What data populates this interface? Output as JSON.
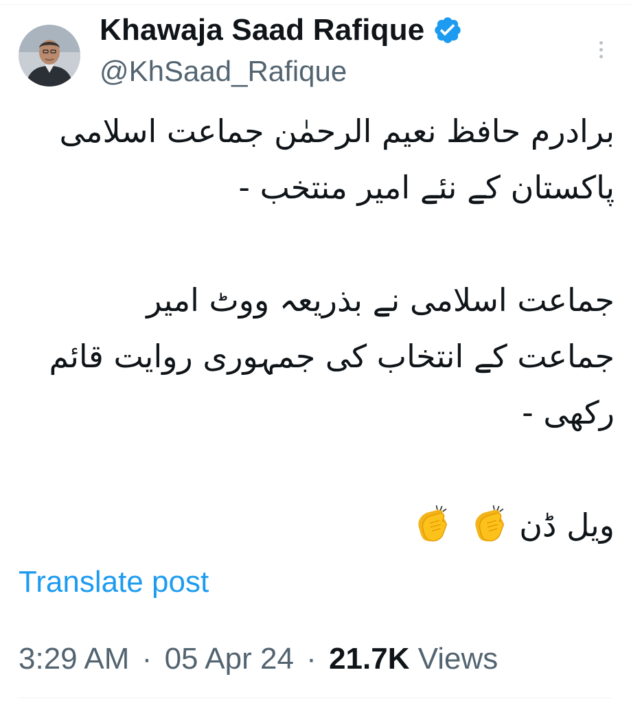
{
  "author": {
    "display_name": "Khawaja Saad Rafique",
    "handle": "@KhSaad_Rafique",
    "verified": true,
    "verified_icon": "verified-badge-icon",
    "verified_color": "#1d9bf0"
  },
  "post": {
    "lines": [
      "برادرم حافظ نعیم الرحمٰن جماعت اسلامی",
      "پاکستان کے نئے امیر منتخب -",
      "",
      "جماعت اسلامی نے بذریعہ  ووٹ امیر",
      "جماعت کے انتخاب کی جمہوری روایت قائم",
      "رکھی -",
      ""
    ],
    "closing_text": "ویل ڈن",
    "emoji": [
      "clapping-hands-icon",
      "clapping-hands-icon"
    ]
  },
  "translate_label": "Translate post",
  "meta": {
    "time": "3:29 AM",
    "separator": "·",
    "date": "05 Apr 24",
    "views_count": "21.7K",
    "views_label": "Views"
  },
  "colors": {
    "link": "#1d9bf0",
    "secondary_text": "#536471",
    "primary_text": "#0f1419"
  }
}
